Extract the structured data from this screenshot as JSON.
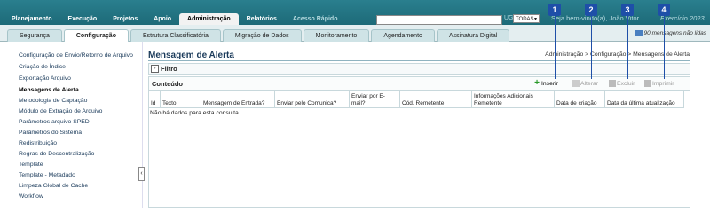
{
  "top_menu": {
    "items": [
      "Planejamento",
      "Execução",
      "Projetos",
      "Apoio",
      "Administração",
      "Relatórios"
    ],
    "active": "Administração",
    "quick_access": "Acesso Rápido"
  },
  "header": {
    "ug_label": "UG",
    "ug_value": "TODAS",
    "welcome": "Seja bem-vindo(a), João Vitor",
    "exercise": "Exercício 2023",
    "messages": "90 mensagens não lidas"
  },
  "sub_tabs": {
    "items": [
      "Segurança",
      "Configuração",
      "Estrutura Classificatória",
      "Migração de Dados",
      "Monitoramento",
      "Agendamento",
      "Assinatura Digital"
    ],
    "active": "Configuração"
  },
  "sidebar": {
    "items": [
      "Configuração de Envio/Retorno de Arquivo",
      "Criação de Índice",
      "Exportação Arquivo",
      "Mensagens de Alerta",
      "Metodologia de Captação",
      "Módulo de Extração de Arquivo",
      "Parâmetros arquivo SPED",
      "Parâmetros do Sistema",
      "Redistribuição",
      "Regras de Descentralização",
      "Template",
      "Template - Metadado",
      "Limpeza Global de Cache",
      "Workflow"
    ],
    "active": "Mensagens de Alerta"
  },
  "main": {
    "title": "Mensagem de Alerta",
    "breadcrumb": "Administração > Configuração > Mensagens de Alerta",
    "filter_label": "Filtro",
    "content_label": "Conteúdo",
    "toolbar": {
      "insert": "Inserir",
      "edit": "Alterar",
      "delete": "Excluir",
      "print": "Imprimir"
    },
    "columns": [
      "Id",
      "Texto",
      "Mensagem de Entrada?",
      "Enviar pelo Comunica?",
      "Enviar por E-mail?",
      "Cód. Remetente",
      "Informações Adicionais Remetente",
      "Data de criação",
      "Data da última atualização"
    ],
    "empty_message": "Não há dados para esta consulta."
  },
  "callouts": [
    "1",
    "2",
    "3",
    "4"
  ],
  "colors": {
    "topbar": "#1d6a78",
    "callout": "#1e4fa8",
    "insert_icon": "#2a9a2a"
  }
}
